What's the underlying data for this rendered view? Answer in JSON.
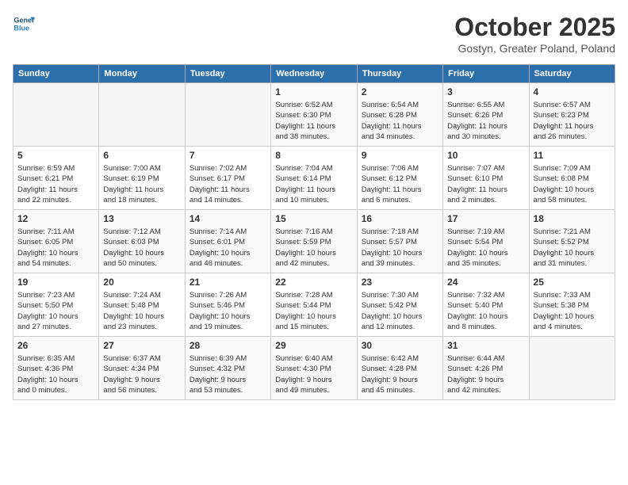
{
  "logo": {
    "line1": "General",
    "line2": "Blue"
  },
  "title": "October 2025",
  "subtitle": "Gostyn, Greater Poland, Poland",
  "days_of_week": [
    "Sunday",
    "Monday",
    "Tuesday",
    "Wednesday",
    "Thursday",
    "Friday",
    "Saturday"
  ],
  "weeks": [
    [
      {
        "day": "",
        "content": ""
      },
      {
        "day": "",
        "content": ""
      },
      {
        "day": "",
        "content": ""
      },
      {
        "day": "1",
        "content": "Sunrise: 6:52 AM\nSunset: 6:30 PM\nDaylight: 11 hours\nand 38 minutes."
      },
      {
        "day": "2",
        "content": "Sunrise: 6:54 AM\nSunset: 6:28 PM\nDaylight: 11 hours\nand 34 minutes."
      },
      {
        "day": "3",
        "content": "Sunrise: 6:55 AM\nSunset: 6:26 PM\nDaylight: 11 hours\nand 30 minutes."
      },
      {
        "day": "4",
        "content": "Sunrise: 6:57 AM\nSunset: 6:23 PM\nDaylight: 11 hours\nand 26 minutes."
      }
    ],
    [
      {
        "day": "5",
        "content": "Sunrise: 6:59 AM\nSunset: 6:21 PM\nDaylight: 11 hours\nand 22 minutes."
      },
      {
        "day": "6",
        "content": "Sunrise: 7:00 AM\nSunset: 6:19 PM\nDaylight: 11 hours\nand 18 minutes."
      },
      {
        "day": "7",
        "content": "Sunrise: 7:02 AM\nSunset: 6:17 PM\nDaylight: 11 hours\nand 14 minutes."
      },
      {
        "day": "8",
        "content": "Sunrise: 7:04 AM\nSunset: 6:14 PM\nDaylight: 11 hours\nand 10 minutes."
      },
      {
        "day": "9",
        "content": "Sunrise: 7:06 AM\nSunset: 6:12 PM\nDaylight: 11 hours\nand 6 minutes."
      },
      {
        "day": "10",
        "content": "Sunrise: 7:07 AM\nSunset: 6:10 PM\nDaylight: 11 hours\nand 2 minutes."
      },
      {
        "day": "11",
        "content": "Sunrise: 7:09 AM\nSunset: 6:08 PM\nDaylight: 10 hours\nand 58 minutes."
      }
    ],
    [
      {
        "day": "12",
        "content": "Sunrise: 7:11 AM\nSunset: 6:05 PM\nDaylight: 10 hours\nand 54 minutes."
      },
      {
        "day": "13",
        "content": "Sunrise: 7:12 AM\nSunset: 6:03 PM\nDaylight: 10 hours\nand 50 minutes."
      },
      {
        "day": "14",
        "content": "Sunrise: 7:14 AM\nSunset: 6:01 PM\nDaylight: 10 hours\nand 46 minutes."
      },
      {
        "day": "15",
        "content": "Sunrise: 7:16 AM\nSunset: 5:59 PM\nDaylight: 10 hours\nand 42 minutes."
      },
      {
        "day": "16",
        "content": "Sunrise: 7:18 AM\nSunset: 5:57 PM\nDaylight: 10 hours\nand 39 minutes."
      },
      {
        "day": "17",
        "content": "Sunrise: 7:19 AM\nSunset: 5:54 PM\nDaylight: 10 hours\nand 35 minutes."
      },
      {
        "day": "18",
        "content": "Sunrise: 7:21 AM\nSunset: 5:52 PM\nDaylight: 10 hours\nand 31 minutes."
      }
    ],
    [
      {
        "day": "19",
        "content": "Sunrise: 7:23 AM\nSunset: 5:50 PM\nDaylight: 10 hours\nand 27 minutes."
      },
      {
        "day": "20",
        "content": "Sunrise: 7:24 AM\nSunset: 5:48 PM\nDaylight: 10 hours\nand 23 minutes."
      },
      {
        "day": "21",
        "content": "Sunrise: 7:26 AM\nSunset: 5:46 PM\nDaylight: 10 hours\nand 19 minutes."
      },
      {
        "day": "22",
        "content": "Sunrise: 7:28 AM\nSunset: 5:44 PM\nDaylight: 10 hours\nand 15 minutes."
      },
      {
        "day": "23",
        "content": "Sunrise: 7:30 AM\nSunset: 5:42 PM\nDaylight: 10 hours\nand 12 minutes."
      },
      {
        "day": "24",
        "content": "Sunrise: 7:32 AM\nSunset: 5:40 PM\nDaylight: 10 hours\nand 8 minutes."
      },
      {
        "day": "25",
        "content": "Sunrise: 7:33 AM\nSunset: 5:38 PM\nDaylight: 10 hours\nand 4 minutes."
      }
    ],
    [
      {
        "day": "26",
        "content": "Sunrise: 6:35 AM\nSunset: 4:36 PM\nDaylight: 10 hours\nand 0 minutes."
      },
      {
        "day": "27",
        "content": "Sunrise: 6:37 AM\nSunset: 4:34 PM\nDaylight: 9 hours\nand 56 minutes."
      },
      {
        "day": "28",
        "content": "Sunrise: 6:39 AM\nSunset: 4:32 PM\nDaylight: 9 hours\nand 53 minutes."
      },
      {
        "day": "29",
        "content": "Sunrise: 6:40 AM\nSunset: 4:30 PM\nDaylight: 9 hours\nand 49 minutes."
      },
      {
        "day": "30",
        "content": "Sunrise: 6:42 AM\nSunset: 4:28 PM\nDaylight: 9 hours\nand 45 minutes."
      },
      {
        "day": "31",
        "content": "Sunrise: 6:44 AM\nSunset: 4:26 PM\nDaylight: 9 hours\nand 42 minutes."
      },
      {
        "day": "",
        "content": ""
      }
    ]
  ]
}
